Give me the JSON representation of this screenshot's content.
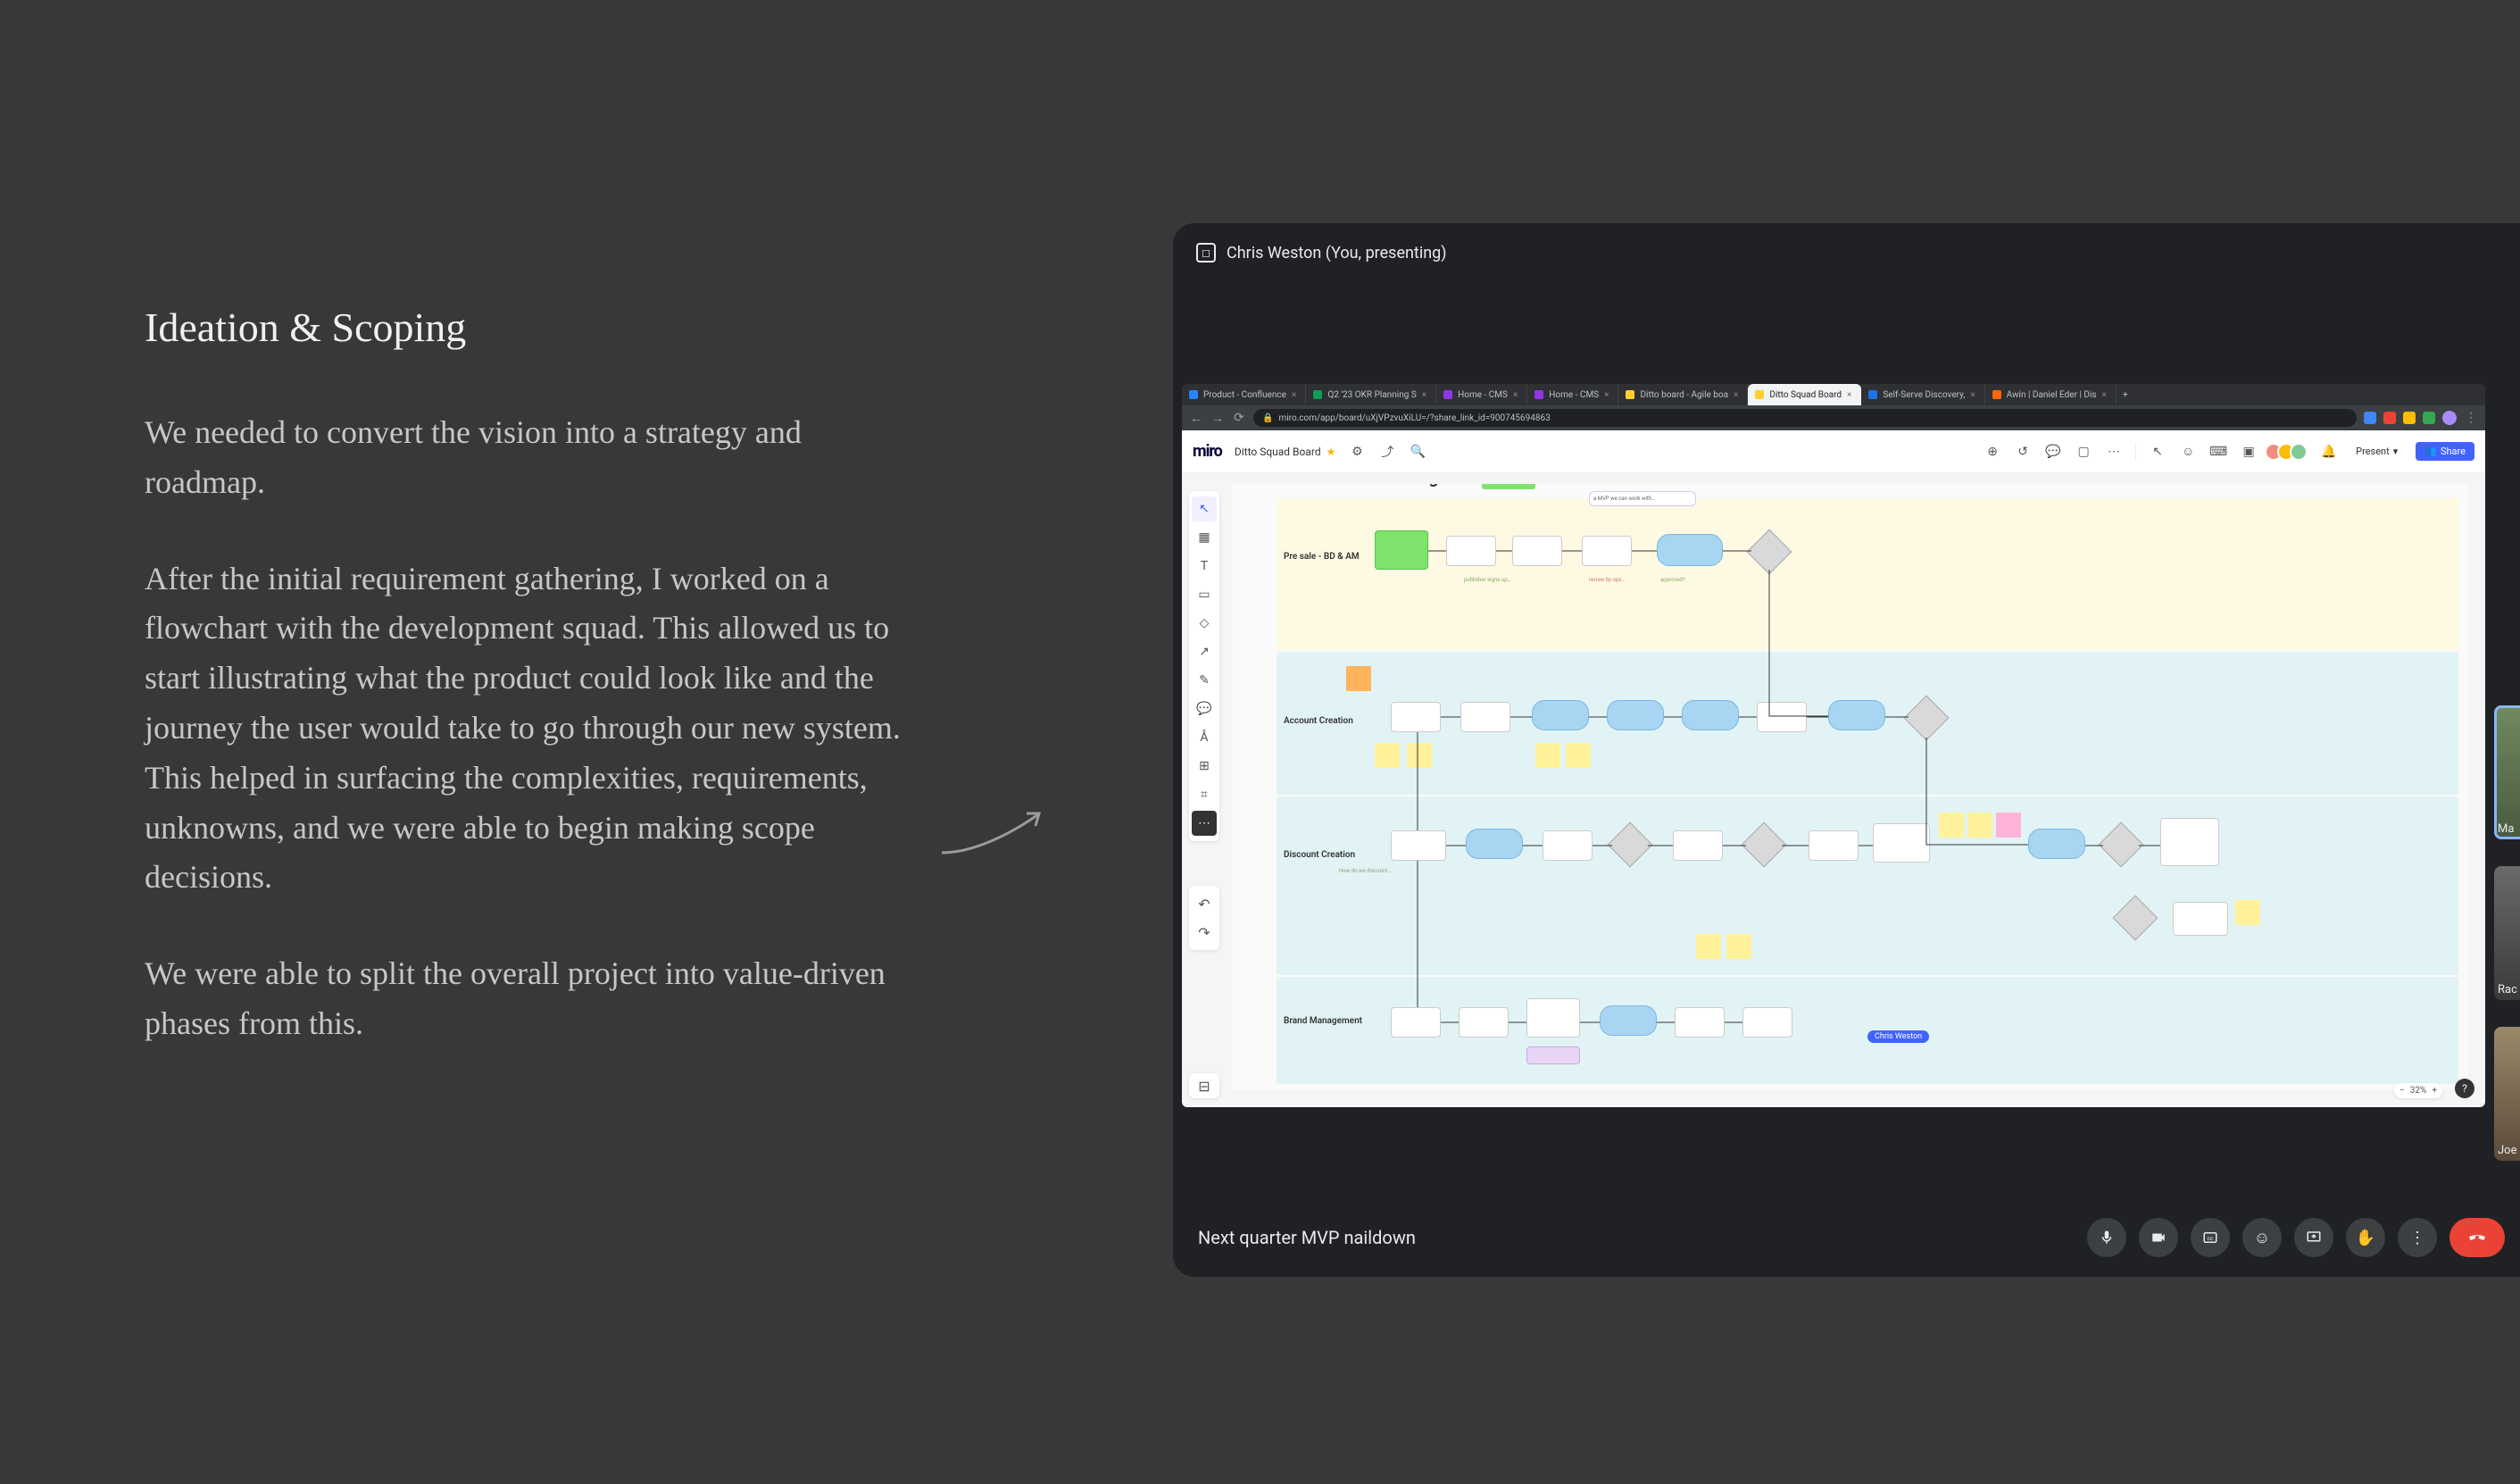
{
  "slide": {
    "heading": "Ideation & Scoping",
    "p1": "We needed to convert the vision into a strategy and roadmap.",
    "p2": "After the initial requirement gathering, I worked on a flowchart with the development squad. This allowed us to start illustrating what the product could look like and the journey the user would take to go through our new system. This helped in surfacing the complexities, requirements, unknowns, and we were able to begin making scope decisions.",
    "p3": "We were able to split the overall project into value-driven phases from this."
  },
  "meet": {
    "presenter_label": "Chris Weston (You, presenting)",
    "meeting_title": "Next quarter MVP naildown",
    "participants": [
      {
        "label": "Ma"
      },
      {
        "label": "Rac"
      },
      {
        "label": "Joe"
      }
    ]
  },
  "browser": {
    "tabs": [
      {
        "label": "Product - Confluence",
        "color": "#2684ff",
        "active": false
      },
      {
        "label": "Q2 '23 OKR Planning S",
        "color": "#0f9d58",
        "active": false
      },
      {
        "label": "Home - CMS",
        "color": "#9334e6",
        "active": false
      },
      {
        "label": "Home - CMS",
        "color": "#9334e6",
        "active": false
      },
      {
        "label": "Ditto board - Agile boa",
        "color": "#ffd02f",
        "active": false
      },
      {
        "label": "Ditto Squad Board",
        "color": "#ffd02f",
        "active": true
      },
      {
        "label": "Self-Serve Discovery,",
        "color": "#1a73e8",
        "active": false
      },
      {
        "label": "Awin | Daniel Eder | Dis",
        "color": "#ff6600",
        "active": false
      }
    ],
    "url": "miro.com/app/board/uXjVPzvuXiLU=/?share_link_id=900745694863"
  },
  "miro": {
    "logo": "miro",
    "board_name": "Ditto Squad Board",
    "present_label": "Present",
    "share_label": "Share",
    "zoom_value": "32%",
    "cursor_name": "Chris Weston",
    "lanes": [
      {
        "label": "Pre sale - BD & AM"
      },
      {
        "label": "Account Creation"
      },
      {
        "label": "Discount Creation"
      },
      {
        "label": "Brand Management"
      }
    ]
  }
}
